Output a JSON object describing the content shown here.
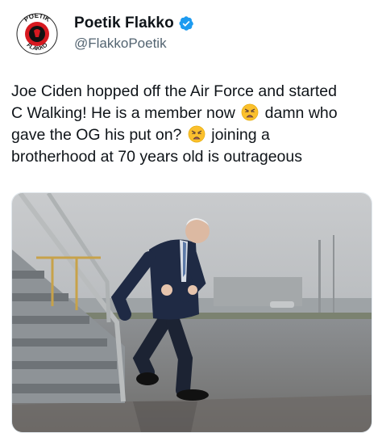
{
  "author": {
    "display_name": "Poetik Flakko",
    "handle": "@FlakkoPoetik",
    "verified": true,
    "avatar": {
      "top_text": "POETIK",
      "bottom_text": "FLAKKO",
      "colors": {
        "ring": "#ffffff",
        "disc": "#d71920",
        "inner": "#111111"
      }
    }
  },
  "tweet": {
    "lines": [
      {
        "text": "Joe Ciden hopped off the Air Force and started"
      },
      {
        "before": "C Walking! He is a member now",
        "emoji": "weary-face-emoji",
        "after": "damn who"
      },
      {
        "before": "gave the OG his put on?",
        "emoji": "weary-face-emoji",
        "after": "joining a"
      },
      {
        "text": "brotherhood at 70 years old is outrageous"
      }
    ]
  },
  "colors": {
    "verified": "#1d9bf0",
    "handle": "#536471",
    "text": "#0f1419",
    "emoji": "#fbc02d"
  },
  "media": {
    "description_icon": "photo-icon"
  }
}
